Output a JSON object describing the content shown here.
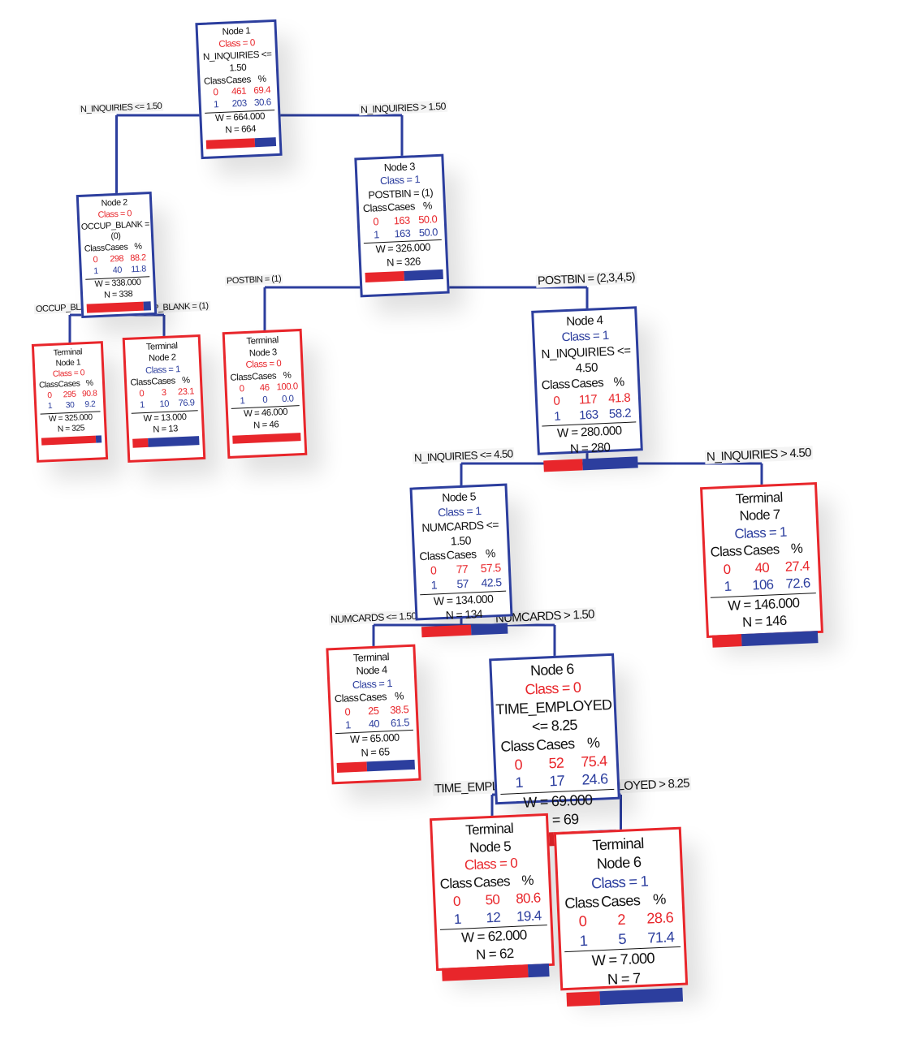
{
  "colors": {
    "class0": "#e8262b",
    "class1": "#2c3e9e"
  },
  "table_header": [
    "Class",
    "Cases",
    "%"
  ],
  "nodes": [
    {
      "id": "n1",
      "title": [
        "Node 1"
      ],
      "cls": "0",
      "class_label": "Class = 0",
      "split": "N_INQUIRIES <= 1.50",
      "rows": [
        [
          "0",
          "461",
          "69.4"
        ],
        [
          "1",
          "203",
          "30.6"
        ]
      ],
      "w": "W = 664.000",
      "n": "N = 664",
      "p0": 69.4
    },
    {
      "id": "n2",
      "title": [
        "Node 2"
      ],
      "cls": "0",
      "class_label": "Class = 0",
      "split": "OCCUP_BLANK = (0)",
      "rows": [
        [
          "0",
          "298",
          "88.2"
        ],
        [
          "1",
          "40",
          "11.8"
        ]
      ],
      "w": "W = 338.000",
      "n": "N = 338",
      "p0": 88.2
    },
    {
      "id": "n3",
      "title": [
        "Node 3"
      ],
      "cls": "1",
      "class_label": "Class = 1",
      "split": "POSTBIN = (1)",
      "rows": [
        [
          "0",
          "163",
          "50.0"
        ],
        [
          "1",
          "163",
          "50.0"
        ]
      ],
      "w": "W = 326.000",
      "n": "N = 326",
      "p0": 50.0
    },
    {
      "id": "t1",
      "title": [
        "Terminal",
        "Node 1"
      ],
      "cls": "0",
      "class_label": "Class = 0",
      "rows": [
        [
          "0",
          "295",
          "90.8"
        ],
        [
          "1",
          "30",
          "9.2"
        ]
      ],
      "w": "W = 325.000",
      "n": "N = 325",
      "p0": 90.8
    },
    {
      "id": "t2",
      "title": [
        "Terminal",
        "Node 2"
      ],
      "cls": "1",
      "class_label": "Class = 1",
      "rows": [
        [
          "0",
          "3",
          "23.1"
        ],
        [
          "1",
          "10",
          "76.9"
        ]
      ],
      "w": "W = 13.000",
      "n": "N = 13",
      "p0": 23.1
    },
    {
      "id": "t3",
      "title": [
        "Terminal",
        "Node 3"
      ],
      "cls": "0",
      "class_label": "Class = 0",
      "rows": [
        [
          "0",
          "46",
          "100.0"
        ],
        [
          "1",
          "0",
          "0.0"
        ]
      ],
      "w": "W = 46.000",
      "n": "N = 46",
      "p0": 100.0
    },
    {
      "id": "n4",
      "title": [
        "Node 4"
      ],
      "cls": "1",
      "class_label": "Class = 1",
      "split": "N_INQUIRIES <= 4.50",
      "rows": [
        [
          "0",
          "117",
          "41.8"
        ],
        [
          "1",
          "163",
          "58.2"
        ]
      ],
      "w": "W = 280.000",
      "n": "N = 280",
      "p0": 41.8
    },
    {
      "id": "n5",
      "title": [
        "Node 5"
      ],
      "cls": "1",
      "class_label": "Class = 1",
      "split": "NUMCARDS <= 1.50",
      "rows": [
        [
          "0",
          "77",
          "57.5"
        ],
        [
          "1",
          "57",
          "42.5"
        ]
      ],
      "w": "W = 134.000",
      "n": "N = 134",
      "p0": 57.5
    },
    {
      "id": "t7",
      "title": [
        "Terminal",
        "Node 7"
      ],
      "cls": "1",
      "class_label": "Class = 1",
      "rows": [
        [
          "0",
          "40",
          "27.4"
        ],
        [
          "1",
          "106",
          "72.6"
        ]
      ],
      "w": "W = 146.000",
      "n": "N = 146",
      "p0": 27.4
    },
    {
      "id": "t4",
      "title": [
        "Terminal",
        "Node 4"
      ],
      "cls": "1",
      "class_label": "Class = 1",
      "rows": [
        [
          "0",
          "25",
          "38.5"
        ],
        [
          "1",
          "40",
          "61.5"
        ]
      ],
      "w": "W = 65.000",
      "n": "N = 65",
      "p0": 38.5
    },
    {
      "id": "n6",
      "title": [
        "Node 6"
      ],
      "cls": "0",
      "class_label": "Class = 0",
      "split": "TIME_EMPLOYED <= 8.25",
      "rows": [
        [
          "0",
          "52",
          "75.4"
        ],
        [
          "1",
          "17",
          "24.6"
        ]
      ],
      "w": "W = 69.000",
      "n": "N = 69",
      "p0": 75.4
    },
    {
      "id": "t5",
      "title": [
        "Terminal",
        "Node 5"
      ],
      "cls": "0",
      "class_label": "Class = 0",
      "rows": [
        [
          "0",
          "50",
          "80.6"
        ],
        [
          "1",
          "12",
          "19.4"
        ]
      ],
      "w": "W = 62.000",
      "n": "N = 62",
      "p0": 80.6
    },
    {
      "id": "t6",
      "title": [
        "Terminal",
        "Node 6"
      ],
      "cls": "1",
      "class_label": "Class = 1",
      "rows": [
        [
          "0",
          "2",
          "28.6"
        ],
        [
          "1",
          "5",
          "71.4"
        ]
      ],
      "w": "W = 7.000",
      "n": "N = 7",
      "p0": 28.6
    }
  ],
  "edges": [
    {
      "from": "n1",
      "to": "n2",
      "label": "N_INQUIRIES <= 1.50"
    },
    {
      "from": "n1",
      "to": "n3",
      "label": "N_INQUIRIES >  1.50"
    },
    {
      "from": "n2",
      "to": "t1",
      "label": "OCCUP_BLANK = (0)"
    },
    {
      "from": "n2",
      "to": "t2",
      "label": "OCCUP_BLANK = (1)"
    },
    {
      "from": "n3",
      "to": "t3",
      "label": "POSTBIN = (1)"
    },
    {
      "from": "n3",
      "to": "n4",
      "label": "POSTBIN = (2,3,4,5)"
    },
    {
      "from": "n4",
      "to": "n5",
      "label": "N_INQUIRIES <= 4.50"
    },
    {
      "from": "n4",
      "to": "t7",
      "label": "N_INQUIRIES >  4.50"
    },
    {
      "from": "n5",
      "to": "t4",
      "label": "NUMCARDS <= 1.50"
    },
    {
      "from": "n5",
      "to": "n6",
      "label": "NUMCARDS >  1.50"
    },
    {
      "from": "n6",
      "to": "t5",
      "label": "TIME_EMPLOYED <= 8.25"
    },
    {
      "from": "n6",
      "to": "t6",
      "label": "TIME_EMPLOYED >  8.25"
    }
  ]
}
